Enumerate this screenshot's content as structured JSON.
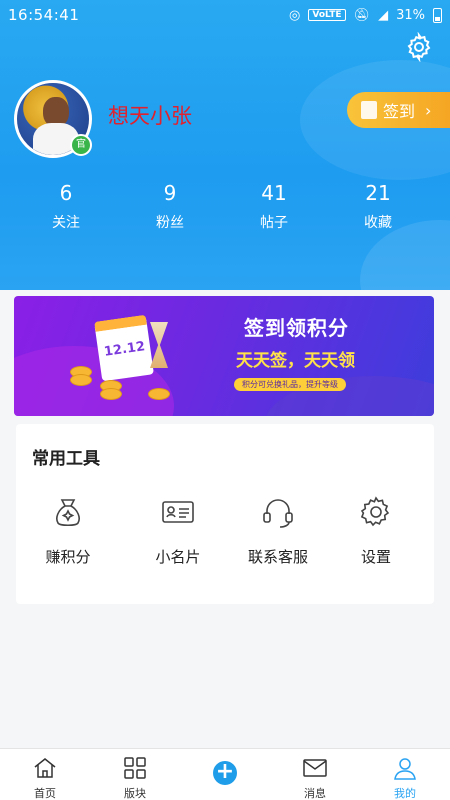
{
  "status_bar": {
    "time": "16:54:41",
    "network": "VoLTE",
    "battery_text": "31%"
  },
  "profile": {
    "username": "想天小张",
    "badge": "官",
    "signin_label": "签到"
  },
  "stats": [
    {
      "value": "6",
      "label": "关注"
    },
    {
      "value": "9",
      "label": "粉丝"
    },
    {
      "value": "41",
      "label": "帖子"
    },
    {
      "value": "21",
      "label": "收藏"
    }
  ],
  "banner": {
    "title": "签到领积分",
    "subtitle": "天天签，天天领",
    "note": "积分可兑换礼品，提升等级",
    "calendar_text": "12.12"
  },
  "tools": {
    "title": "常用工具",
    "items": [
      {
        "label": "赚积分",
        "icon": "money-bag-icon"
      },
      {
        "label": "小名片",
        "icon": "id-card-icon"
      },
      {
        "label": "联系客服",
        "icon": "headset-icon"
      },
      {
        "label": "设置",
        "icon": "gear-icon"
      }
    ]
  },
  "tabbar": {
    "items": [
      {
        "label": "首页",
        "icon": "home-icon"
      },
      {
        "label": "版块",
        "icon": "grid-icon"
      },
      {
        "label": "",
        "icon": "plus-icon"
      },
      {
        "label": "消息",
        "icon": "mail-icon"
      },
      {
        "label": "我的",
        "icon": "person-icon"
      }
    ],
    "active_color": "#2aa3f2"
  },
  "colors": {
    "header_blue": "#1e9cf0",
    "username_red": "#e0222e",
    "signin_orange": "#f5a623"
  }
}
